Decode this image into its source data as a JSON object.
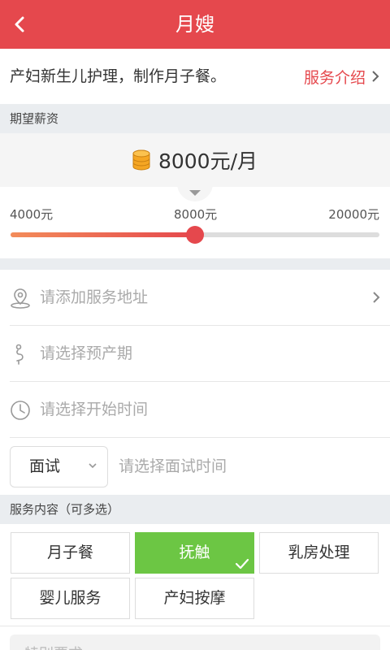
{
  "header": {
    "title": "月嫂",
    "back_icon": "back-arrow-icon"
  },
  "intro": {
    "description": "产妇新生儿护理，制作月子餐。",
    "link_label": "服务介绍"
  },
  "salary": {
    "section_title": "期望薪资",
    "current_display": "8000元/月",
    "min_label": "4000元",
    "current_label": "8000元",
    "max_label": "20000元",
    "slider_fraction": 0.5
  },
  "form": {
    "address_placeholder": "请添加服务地址",
    "due_date_placeholder": "请选择预产期",
    "start_time_placeholder": "请选择开始时间",
    "interview_type": "面试",
    "interview_time_placeholder": "请选择面试时间"
  },
  "services": {
    "section_title": "服务内容（可多选）",
    "options": [
      {
        "label": "月子餐",
        "selected": false
      },
      {
        "label": "抚触",
        "selected": true
      },
      {
        "label": "乳房处理",
        "selected": false
      },
      {
        "label": "婴儿服务",
        "selected": false
      },
      {
        "label": "产妇按摩",
        "selected": false
      }
    ]
  },
  "special": {
    "placeholder": "特别要求"
  },
  "colors": {
    "accent": "#e5484d",
    "selected": "#6cc644",
    "coin": "#f5a623",
    "section_bg": "#eaedf0"
  }
}
